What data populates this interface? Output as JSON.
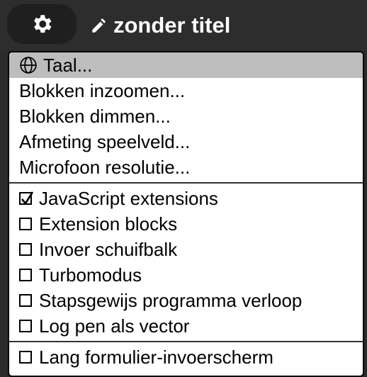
{
  "header": {
    "settings_icon": "gear-icon",
    "title_icon": "pencil-icon",
    "title": "zonder titel"
  },
  "menu": {
    "group1": [
      {
        "label": "Taal...",
        "icon": "globe-icon",
        "highlighted": true
      },
      {
        "label": "Blokken inzoomen..."
      },
      {
        "label": "Blokken dimmen..."
      },
      {
        "label": "Afmeting speelveld..."
      },
      {
        "label": "Microfoon resolutie..."
      }
    ],
    "group2": [
      {
        "label": "JavaScript extensions",
        "checked": true
      },
      {
        "label": "Extension blocks",
        "checked": false
      },
      {
        "label": "Invoer schuifbalk",
        "checked": false
      },
      {
        "label": "Turbomodus",
        "checked": false
      },
      {
        "label": "Stapsgewijs programma verloop",
        "checked": false
      },
      {
        "label": "Log pen als vector",
        "checked": false
      }
    ],
    "group3": [
      {
        "label": "Lang formulier-invoerscherm",
        "checked": false
      }
    ]
  },
  "colors": {
    "topbar_bg": "#2d2d2d",
    "highlight_bg": "#bdbdbd",
    "menu_bg": "#ffffff"
  }
}
